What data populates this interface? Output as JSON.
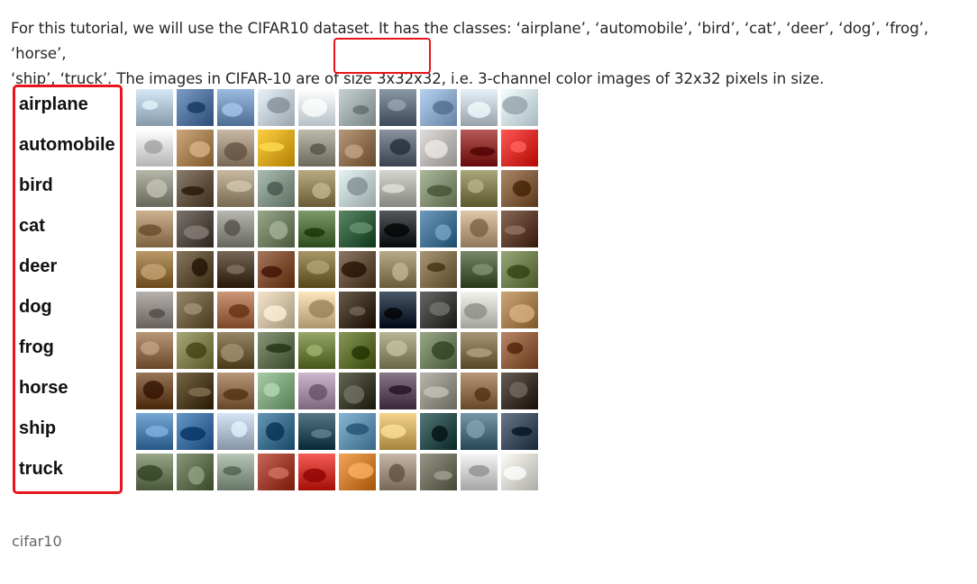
{
  "intro": {
    "line1": "For this tutorial, we will use the CIFAR10 dataset. It has the classes: ‘airplane’, ‘automobile’, ‘bird’, ‘cat’, ‘deer’, ‘dog’, ‘frog’, ‘horse’,",
    "line2_before": "‘ship’, ‘truck’. The images in CIFAR-10 are of ",
    "line2_highlight": "size 3x32x32",
    "line2_after": ", i.e. 3-channel color images of 32x32 pixels in size."
  },
  "classes": [
    "airplane",
    "automobile",
    "bird",
    "cat",
    "deer",
    "dog",
    "frog",
    "horse",
    "ship",
    "truck"
  ],
  "colors": {
    "highlight": "#e8141b",
    "rows": [
      [
        "#a8bccb",
        "#4d6f9a",
        "#6f8fb5",
        "#bcc6cf",
        "#d9e4ea",
        "#9aa6a6",
        "#5e6c7a",
        "#88a5c6",
        "#b9c4cc",
        "#c9dbe2"
      ],
      [
        "#d8d8d8",
        "#a07b4e",
        "#9b8b78",
        "#d4a216",
        "#8f8d7d",
        "#8a6b4d",
        "#5c6570",
        "#b3b0ae",
        "#8a2c2a",
        "#d52a26"
      ],
      [
        "#8a8a7c",
        "#5f4f3e",
        "#9a8d74",
        "#7e8f84",
        "#8b7e56",
        "#b9c7c9",
        "#a9a9a3",
        "#7f8b6e",
        "#7d7a4d",
        "#7c5a3b"
      ],
      [
        "#a08463",
        "#4f4640",
        "#8a8a82",
        "#6c7a5e",
        "#4f6e3e",
        "#2f5a3a",
        "#272b2d",
        "#3f6e8e",
        "#b39a7c",
        "#5a3a2a"
      ],
      [
        "#8c6b3c",
        "#5a4a32",
        "#4a3a2a",
        "#7a4a2e",
        "#7a6a3a",
        "#5e4a36",
        "#8a7e5e",
        "#7a6a4a",
        "#4a5a3a",
        "#6a7a4a"
      ],
      [
        "#8a8480",
        "#6a5a3e",
        "#a06a4a",
        "#c8b89e",
        "#d0b890",
        "#3a2e1e",
        "#1a2a3a",
        "#3a3a38",
        "#c6c6c0",
        "#a07a4a"
      ],
      [
        "#8a6a4a",
        "#7a7a4a",
        "#6a5a3a",
        "#5a6a4a",
        "#6a7a3a",
        "#5a6a2a",
        "#8a8a6a",
        "#6a7a5a",
        "#7a6a4a",
        "#8a5a3a"
      ],
      [
        "#6a4a2a",
        "#4a3a1a",
        "#8a6a4a",
        "#7aa07a",
        "#a08aa0",
        "#3a3a2a",
        "#5a4a5a",
        "#8a8a80",
        "#8a6a4a",
        "#3a3028"
      ],
      [
        "#4a7aa8",
        "#3a6a9a",
        "#a8b8c8",
        "#3a6a8a",
        "#2a4a5a",
        "#5a8aa8",
        "#c8a860",
        "#2a4a4a",
        "#4a6a7a",
        "#3a4a5a"
      ],
      [
        "#6a7a5a",
        "#5a6a4a",
        "#8a9a8a",
        "#9a3a2a",
        "#c8302a",
        "#c8782a",
        "#9a8a7a",
        "#6a6a5a",
        "#c8c8c8",
        "#d0d0c8"
      ]
    ]
  },
  "caption": "cifar10"
}
